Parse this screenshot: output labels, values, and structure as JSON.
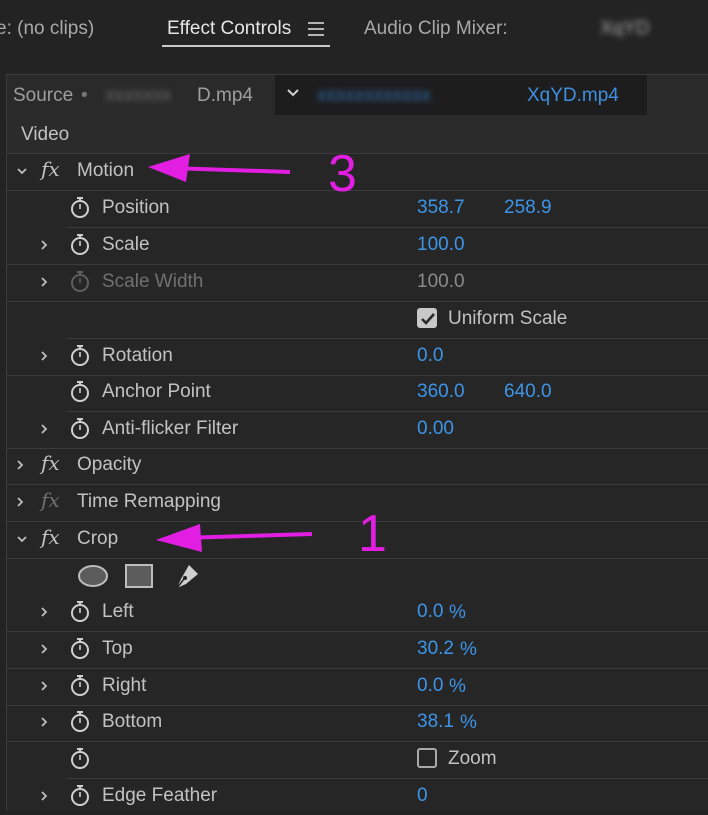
{
  "tabs": [
    {
      "label": "e: (no clips)",
      "active": false
    },
    {
      "label": "Effect Controls",
      "active": true
    },
    {
      "label": "Audio Clip Mixer:",
      "active": false
    },
    {
      "label": "XqYD",
      "active": false
    }
  ],
  "source": {
    "label": "Source",
    "dot": "•",
    "clip_name": "D.mp4",
    "sequence_clip": "XqYD.mp4"
  },
  "section_video": "Video",
  "motion": {
    "label": "Motion",
    "position": {
      "label": "Position",
      "x": "358.7",
      "y": "258.9"
    },
    "scale": {
      "label": "Scale",
      "value": "100.0"
    },
    "scale_width": {
      "label": "Scale Width",
      "value": "100.0"
    },
    "uniform_scale": {
      "label": "Uniform Scale",
      "checked": true
    },
    "rotation": {
      "label": "Rotation",
      "value": "0.0"
    },
    "anchor_point": {
      "label": "Anchor Point",
      "x": "360.0",
      "y": "640.0"
    },
    "anti_flicker": {
      "label": "Anti-flicker Filter",
      "value": "0.00"
    }
  },
  "opacity": {
    "label": "Opacity"
  },
  "time_remapping": {
    "label": "Time Remapping"
  },
  "crop": {
    "label": "Crop",
    "left": {
      "label": "Left",
      "value": "0.0",
      "unit": "%"
    },
    "top": {
      "label": "Top",
      "value": "30.2",
      "unit": "%"
    },
    "right": {
      "label": "Right",
      "value": "0.0",
      "unit": "%"
    },
    "bottom": {
      "label": "Bottom",
      "value": "38.1",
      "unit": "%"
    },
    "zoom": {
      "label": "Zoom",
      "checked": false
    },
    "edge_feather": {
      "label": "Edge Feather",
      "value": "0"
    }
  },
  "annotations": {
    "motion_number": "3",
    "crop_number": "1",
    "color": "#e21ee2"
  },
  "colors": {
    "value_blue": "#3d95e8",
    "background": "#232323"
  }
}
